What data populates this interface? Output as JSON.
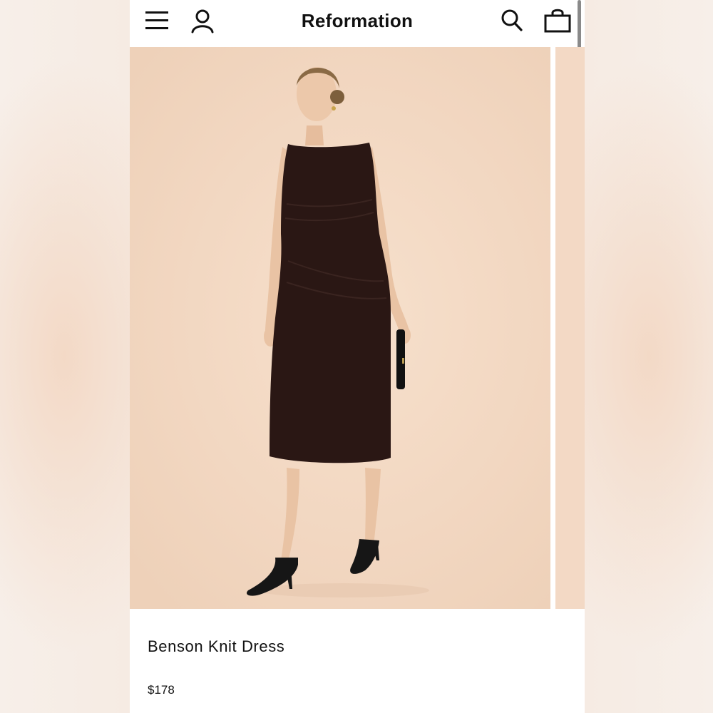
{
  "header": {
    "brand": "Reformation",
    "icons": {
      "menu": "hamburger-menu-icon",
      "account": "user-icon",
      "search": "search-icon",
      "bag": "shopping-bag-icon"
    }
  },
  "product": {
    "name": "Benson Knit Dress",
    "price": "$178"
  },
  "colors": {
    "background": "#ffffff",
    "image_backdrop": "#f2d7c1",
    "dress": "#2a1714",
    "text": "#111111"
  }
}
